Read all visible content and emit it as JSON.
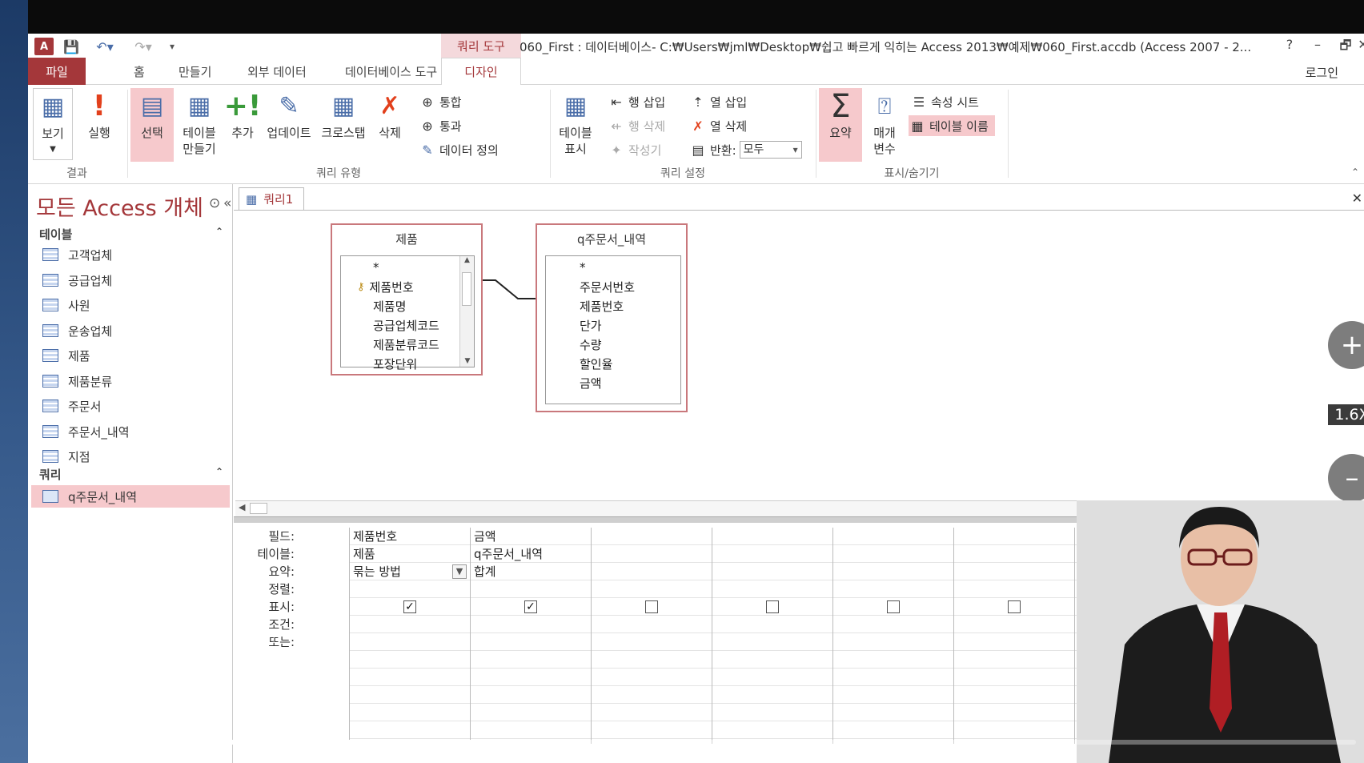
{
  "window": {
    "context_tab": "쿼리 도구",
    "title": "060_First : 데이터베이스- C:₩Users₩jml₩Desktop₩쉽고 빠르게 익히는 Access 2013₩예제₩060_First.accdb (Access 2007 - 2...",
    "help": "?",
    "minimize": "–",
    "restore": "🗗",
    "close": "✕",
    "login": "로그인"
  },
  "tabs": [
    "파일",
    "홈",
    "만들기",
    "외부 데이터",
    "데이터베이스 도구",
    "디자인"
  ],
  "ribbon": {
    "view": "보기",
    "run": "실행",
    "group_results": "결과",
    "select": "선택",
    "make_table": "테이블\n만들기",
    "append": "추가",
    "update": "업데이트",
    "crosstab": "크로스탭",
    "delete": "삭제",
    "union": "통합",
    "pass_through": "통과",
    "data_definition": "데이터 정의",
    "group_query_type": "쿼리 유형",
    "show_table": "테이블\n표시",
    "insert_rows": "행 삽입",
    "delete_rows": "행 삭제",
    "builder": "작성기",
    "insert_columns": "열 삽입",
    "delete_columns": "열 삭제",
    "return_label": "반환:",
    "return_value": "모두",
    "group_query_setup": "쿼리 설정",
    "totals": "요약",
    "parameters": "매개\n변수",
    "property_sheet": "속성 시트",
    "table_names": "테이블 이름",
    "group_show_hide": "표시/숨기기"
  },
  "nav": {
    "title": "모든 Access 개체",
    "tables_header": "테이블",
    "tables": [
      "고객업체",
      "공급업체",
      "사원",
      "운송업체",
      "제품",
      "제품분류",
      "주문서",
      "주문서_내역",
      "지점"
    ],
    "queries_header": "쿼리",
    "queries": [
      "q주문서_내역"
    ]
  },
  "doc": {
    "tab": "쿼리1",
    "close": "✕"
  },
  "tables": [
    {
      "name": "제품",
      "fields": [
        "*",
        "제품번호",
        "제품명",
        "공급업체코드",
        "제품분류코드",
        "포장단위"
      ]
    },
    {
      "name": "q주문서_내역",
      "fields": [
        "*",
        "주문서번호",
        "제품번호",
        "단가",
        "수량",
        "할인율",
        "금액"
      ]
    }
  ],
  "zoom": {
    "in": "+",
    "label": "1.6X",
    "out": "–"
  },
  "grid": {
    "row_labels": [
      "필드:",
      "테이블:",
      "요약:",
      "정렬:",
      "표시:",
      "조건:",
      "또는:"
    ],
    "columns": [
      {
        "field": "제품번호",
        "table": "제품",
        "total": "묶는 방법",
        "show": true
      },
      {
        "field": "금액",
        "table": "q주문서_내역",
        "total": "합계",
        "show": true
      }
    ]
  },
  "playback": {
    "progress": 0.375
  }
}
